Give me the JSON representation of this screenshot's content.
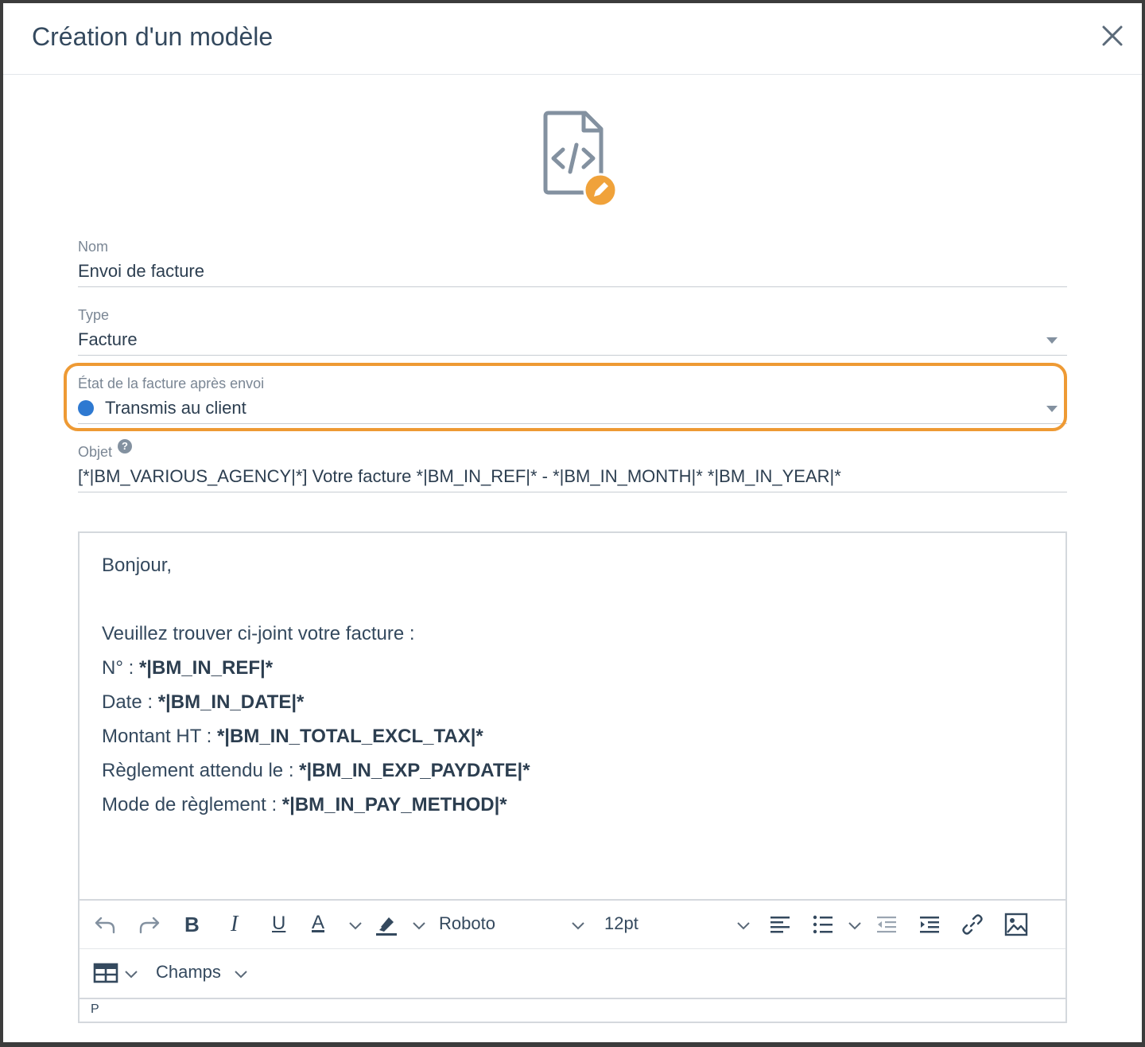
{
  "dialog": {
    "title": "Création d'un modèle"
  },
  "form": {
    "nom": {
      "label": "Nom",
      "value": "Envoi de facture"
    },
    "type": {
      "label": "Type",
      "value": "Facture"
    },
    "etat": {
      "label": "État de la facture après envoi",
      "value": "Transmis au client",
      "dot_color": "#2e79d1"
    },
    "objet": {
      "label": "Objet",
      "help": "?",
      "value": "[*|BM_VARIOUS_AGENCY|*] Votre facture *|BM_IN_REF|* - *|BM_IN_MONTH|* *|BM_IN_YEAR|*"
    }
  },
  "editor": {
    "greeting": "Bonjour,",
    "intro": "Veuillez trouver ci-joint votre facture :",
    "lines": [
      {
        "label": "N° : ",
        "field": "*|BM_IN_REF|*"
      },
      {
        "label": "Date : ",
        "field": "*|BM_IN_DATE|*"
      },
      {
        "label": "Montant HT : ",
        "field": "*|BM_IN_TOTAL_EXCL_TAX|*"
      },
      {
        "label": "Règlement attendu le : ",
        "field": "*|BM_IN_EXP_PAYDATE|*"
      },
      {
        "label": "Mode de règlement : ",
        "field": "*|BM_IN_PAY_METHOD|*"
      }
    ],
    "toolbar": {
      "bold": "B",
      "italic": "I",
      "underline": "U",
      "font_color": "A",
      "font_family": "Roboto",
      "font_size": "12pt",
      "champs": "Champs"
    },
    "status_path": "P"
  },
  "colors": {
    "highlight": "#ee9a34",
    "edit_badge": "#f0a23a"
  }
}
